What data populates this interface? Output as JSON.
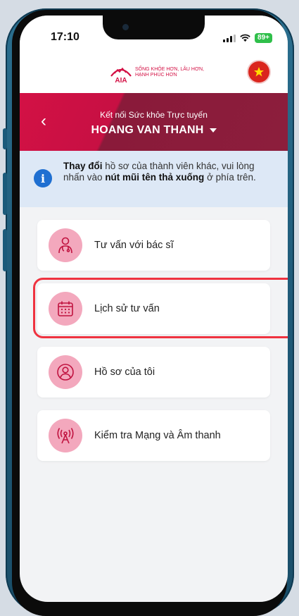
{
  "status_bar": {
    "time": "17:10",
    "battery": "89+"
  },
  "header": {
    "logo_text": "AIA",
    "logo_tagline_line1": "SỐNG KHỎE HƠN, LÂU HƠN,",
    "logo_tagline_line2": "HẠNH PHÚC HƠN",
    "language_flag": "vietnam-flag-icon"
  },
  "banner": {
    "subtitle": "Kết nối Sức khỏe Trực tuyến",
    "member_name": "HOANG VAN THANH"
  },
  "info": {
    "bold1": "Thay đổi",
    "text1": " hồ sơ của thành viên khác, vui lòng nhấn vào ",
    "bold2": "nút mũi tên thả xuống",
    "text2": " ở phía trên."
  },
  "menu": {
    "items": [
      {
        "label": "Tư vấn với bác sĩ",
        "icon": "doctor-icon"
      },
      {
        "label": "Lịch sử tư vấn",
        "icon": "calendar-icon",
        "highlighted": true
      },
      {
        "label": "Hồ sơ của tôi",
        "icon": "user-profile-icon"
      },
      {
        "label": "Kiểm tra Mạng và Âm thanh",
        "icon": "network-antenna-icon"
      }
    ]
  },
  "colors": {
    "brand": "#d31145",
    "banner_dark": "#8c1e3c",
    "info_bg": "#dde8f6",
    "icon_bg": "#f3a8bd",
    "highlight": "#ef3340"
  }
}
